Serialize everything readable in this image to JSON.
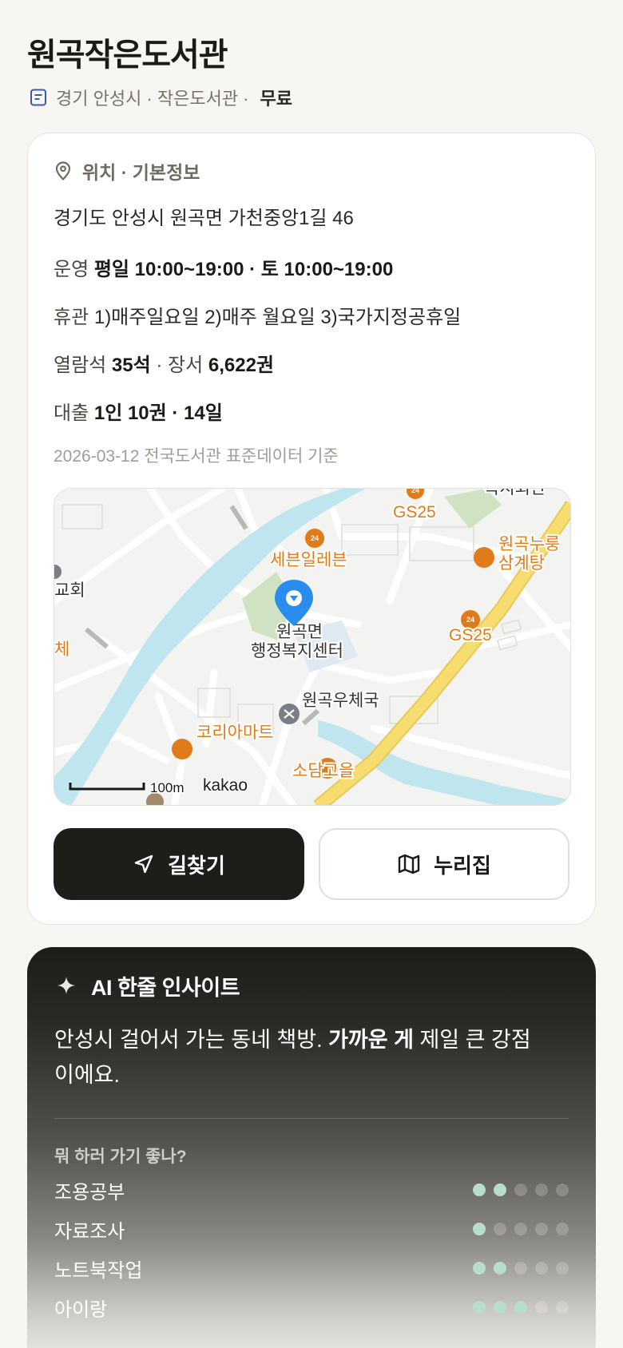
{
  "header": {
    "title": "원곡작은도서관",
    "subtitle": "경기 안성시 · 작은도서관 ·",
    "fee": "무료"
  },
  "info": {
    "section_label": "위치 · 기본정보",
    "address": "경기도 안성시 원곡면 가천중앙1길 46",
    "hours_label": "운영",
    "hours_value": "평일 10:00~19:00 · 토 10:00~19:00",
    "closed_label": "휴관",
    "closed_value": "1)매주일요일 2)매주 월요일 3)국가지정공휴일",
    "seats_label": "열람석",
    "seats_value": "35석",
    "books_label": "· 장서",
    "books_value": "6,622권",
    "loan_label": "대출",
    "loan_value": "1인 10권 · 14일",
    "source": "2026-03-12 전국도서관 표준데이터 기준"
  },
  "map": {
    "labels": {
      "gs25_top": "GS25",
      "welfare": "복지회관",
      "seven": "세븐일레븐",
      "samgye_1": "원곡누룽",
      "samgye_2": "삼계탕",
      "church": "교회",
      "center_1": "원곡면",
      "center_2": "행정복지센터",
      "gs25_right": "GS25",
      "left_edge": "체",
      "post": "원곡우체국",
      "mart": "코리아마트",
      "sodam": "소담고을",
      "scale": "100m",
      "brand": "kakao"
    },
    "colors": {
      "poi": "#e07b1a",
      "pin": "#2b8cf0",
      "river": "#bfe6ee",
      "road_main": "#f7dc6f"
    }
  },
  "actions": {
    "directions": "길찾기",
    "website": "누리집"
  },
  "ai": {
    "title": "AI 한줄 인사이트",
    "text_pre": "안성시 걸어서 가는 동네 책방. ",
    "text_bold": "가까운 게",
    "text_post": " 제일 큰 강점이에요.",
    "question": "뭐 하러 가기 좋나?",
    "activities": [
      {
        "name": "조용공부",
        "level": 2,
        "max": 5
      },
      {
        "name": "자료조사",
        "level": 1,
        "max": 5
      },
      {
        "name": "노트북작업",
        "level": 2,
        "max": 5
      },
      {
        "name": "아이랑",
        "level": 3,
        "max": 5
      }
    ]
  }
}
